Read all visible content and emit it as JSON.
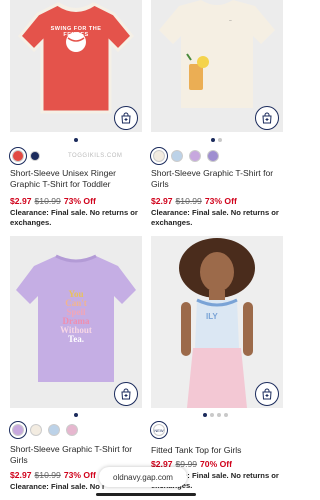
{
  "products": [
    {
      "name": "Short-Sleeve Unisex Ringer Graphic T-Shirt for Toddler",
      "price_now": "$2.97",
      "price_was": "$10.99",
      "discount": "73% Off",
      "clearance": "Clearance: Final sale. No returns or exchanges.",
      "graphic_text": "SWING FOR THE FENCES",
      "watermark": "TOGGIKILS.COM",
      "swatches": [
        "#e24a43",
        "#1b2b5c"
      ]
    },
    {
      "name": "Short-Sleeve Graphic T-Shirt for Girls",
      "price_now": "$2.97",
      "price_was": "$10.99",
      "discount": "73% Off",
      "clearance": "Clearance: Final sale. No returns or exchanges.",
      "swatches": [
        "#f3ece1",
        "#bcd2e8",
        "#c7a8de",
        "#9f8fd0"
      ]
    },
    {
      "name": "Short-Sleeve Graphic T-Shirt for Girls",
      "price_now": "$2.97",
      "price_was": "$10.99",
      "discount": "73% Off",
      "clearance": "Clearance: Final sale. No r",
      "graphic_text": [
        "You",
        "Can't",
        "Spell",
        "Drama",
        "Without",
        "Tea."
      ],
      "swatches": [
        "#c7a8de",
        "#f3ece1",
        "#bcd2e8",
        "#e6b7cf"
      ]
    },
    {
      "name": "Fitted Tank Top for Girls",
      "price_now": "$2.97",
      "price_was": "$9.99",
      "discount": "70% Off",
      "clearance": "Clearance: Final sale. No returns or exchanges.",
      "graphic_text": "ILY",
      "swatch_label": "NEW"
    }
  ],
  "browser": {
    "url": "oldnavy.gap.com"
  },
  "colors": {
    "sale_red": "#d0021b",
    "navy": "#1b2b5c"
  },
  "icons": {
    "bag": "shopping-bag-plus-icon"
  }
}
